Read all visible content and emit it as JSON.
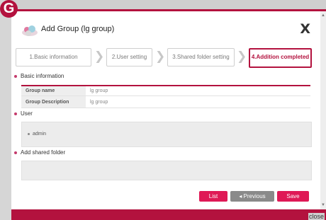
{
  "badge": "G",
  "dialog": {
    "title": "Add Group  (lg group)",
    "close_glyph": "X"
  },
  "steps": [
    {
      "label": "1.Basic information",
      "active": false
    },
    {
      "label": "2.User setting",
      "active": false
    },
    {
      "label": "3.Shared folder setting",
      "active": false
    },
    {
      "label": "4.Addition completed",
      "active": true
    }
  ],
  "basic_info": {
    "heading": "Basic information",
    "rows": [
      {
        "label": "Group name",
        "value": "lg group"
      },
      {
        "label": "Group Description",
        "value": "lg group"
      }
    ]
  },
  "user_section": {
    "heading": "User",
    "users": [
      "admin"
    ]
  },
  "shared_section": {
    "heading": "Add shared folder"
  },
  "buttons": {
    "list": "List",
    "previous": "◂ Previous",
    "save": "Save"
  },
  "footer": {
    "close_text": "close"
  },
  "colors": {
    "accent": "#b3123e",
    "button_primary": "#df1956",
    "button_secondary": "#8a8a8a"
  }
}
